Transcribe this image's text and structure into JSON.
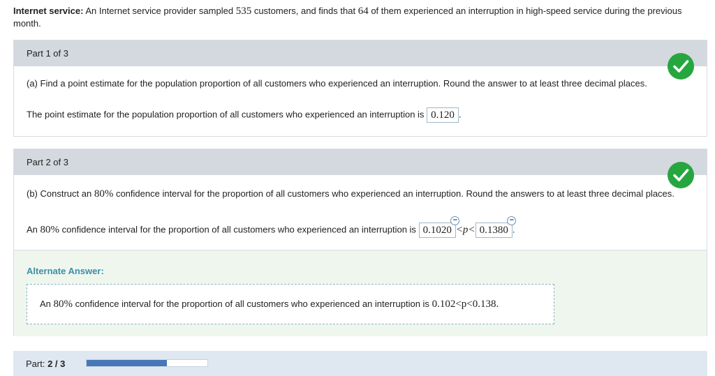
{
  "intro": {
    "heading": "Internet service:",
    "text_a": "An Internet service provider sampled",
    "n": "535",
    "text_b": "customers, and finds that",
    "x": "64",
    "text_c": "of them experienced an interruption in high-speed service during the previous month."
  },
  "part1": {
    "header": "Part 1 of 3",
    "question": "(a) Find a point estimate for the population proportion of all customers who experienced an interruption. Round the answer to at least three decimal places.",
    "answer_prefix": "The point estimate for the population proportion of all customers who experienced an interruption is",
    "answer_value": "0.120",
    "answer_suffix": ".",
    "status": "correct"
  },
  "part2": {
    "header": "Part 2 of 3",
    "question_a": "(b) Construct an",
    "conf": "80%",
    "question_b": "confidence interval for the proportion of all customers who experienced an interruption. Round the answers to at least three decimal places.",
    "answer_prefix_a": "An",
    "answer_prefix_b": "confidence interval for the proportion of all customers who experienced an interruption is",
    "lower": "0.1020",
    "between": "<p<",
    "upper": "0.1380",
    "answer_suffix": ".",
    "status": "correct",
    "alternate_title": "Alternate Answer:",
    "alternate_a": "An",
    "alternate_b": "confidence interval for the proportion of all customers who experienced an interruption is",
    "alternate_math": "0.102<p<0.138."
  },
  "footer": {
    "label": "Part:",
    "progress_text": "2 / 3",
    "progress_fraction": 0.667
  },
  "colors": {
    "check": "#26a63f",
    "progress": "#4677b8",
    "alt_title": "#3b8fa8"
  }
}
